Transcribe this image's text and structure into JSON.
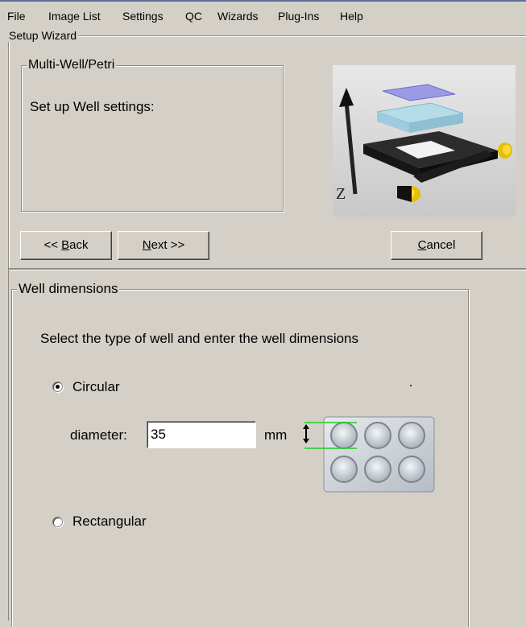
{
  "menu": [
    "File",
    "Image List",
    "Settings",
    "QC",
    "Wizards",
    "Plug-Ins",
    "Help"
  ],
  "wizard": {
    "title": "Setup Wizard",
    "step_group_title": "Multi-Well/Petri",
    "step_text": "Set up Well settings:",
    "image_label": "Z",
    "back_label": "<< ",
    "back_mnemonic": "B",
    "back_rest": "ack",
    "next_mnemonic": "N",
    "next_rest": "ext >>",
    "cancel_mnemonic": "C",
    "cancel_rest": "ancel"
  },
  "well": {
    "group_title": "Well dimensions",
    "instruction": "Select the type of well and enter the well dimensions",
    "circular_label": "Circular",
    "circular_selected": true,
    "diameter_label": "diameter:",
    "diameter_value": "35",
    "unit": "mm",
    "rectangular_label": "Rectangular",
    "rectangular_selected": false
  }
}
